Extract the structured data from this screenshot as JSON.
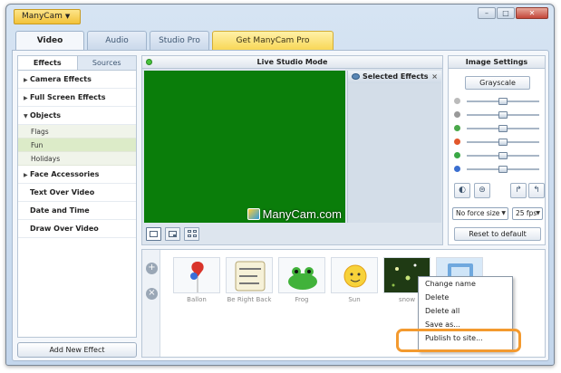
{
  "app": {
    "title": "ManyCam"
  },
  "tabs": [
    {
      "label": "Video",
      "active": true
    },
    {
      "label": "Audio"
    },
    {
      "label": "Studio Pro"
    },
    {
      "label": "Get ManyCam Pro"
    }
  ],
  "left_panel": {
    "subtabs": [
      "Effects",
      "Sources"
    ],
    "categories": {
      "camera": "Camera Effects",
      "fullscreen": "Full Screen Effects",
      "objects": "Objects",
      "face": "Face Accessories",
      "text": "Text Over Video",
      "datetime": "Date and Time",
      "draw": "Draw Over Video"
    },
    "object_items": [
      "Flags",
      "Fun",
      "Holidays"
    ],
    "add_button": "Add New Effect"
  },
  "studio": {
    "title": "Live Studio Mode",
    "selected_effects": "Selected Effects",
    "close": "×",
    "logo_text": "ManyCam.com"
  },
  "image_settings": {
    "title": "Image Settings",
    "grayscale": "Grayscale",
    "sliders": [
      {
        "icon": "brightness-icon",
        "color": "#bbbbbb",
        "level": 0.5
      },
      {
        "icon": "contrast-icon",
        "color": "#999999",
        "level": 0.5
      },
      {
        "icon": "saturation-icon",
        "color": "#4aa84a",
        "level": 0.5
      },
      {
        "icon": "red-icon",
        "color": "#e2572b",
        "level": 0.5
      },
      {
        "icon": "green-icon",
        "color": "#3aa845",
        "level": 0.5
      },
      {
        "icon": "blue-icon",
        "color": "#3b6fd0",
        "level": 0.5
      }
    ],
    "size_option": "No force size",
    "fps_option": "25 fps",
    "reset": "Reset to default"
  },
  "effects_strip": {
    "items": [
      "Ballon",
      "Be Right Back",
      "Frog",
      "Sun",
      "snow"
    ]
  },
  "context_menu": {
    "items": [
      "Change name",
      "Delete",
      "Delete all",
      "Save as...",
      "Publish to site..."
    ]
  },
  "colors": {
    "accent_orange": "#f39a2f",
    "video_green": "#0a7d0a",
    "pro_yellow": "#f8d653"
  }
}
